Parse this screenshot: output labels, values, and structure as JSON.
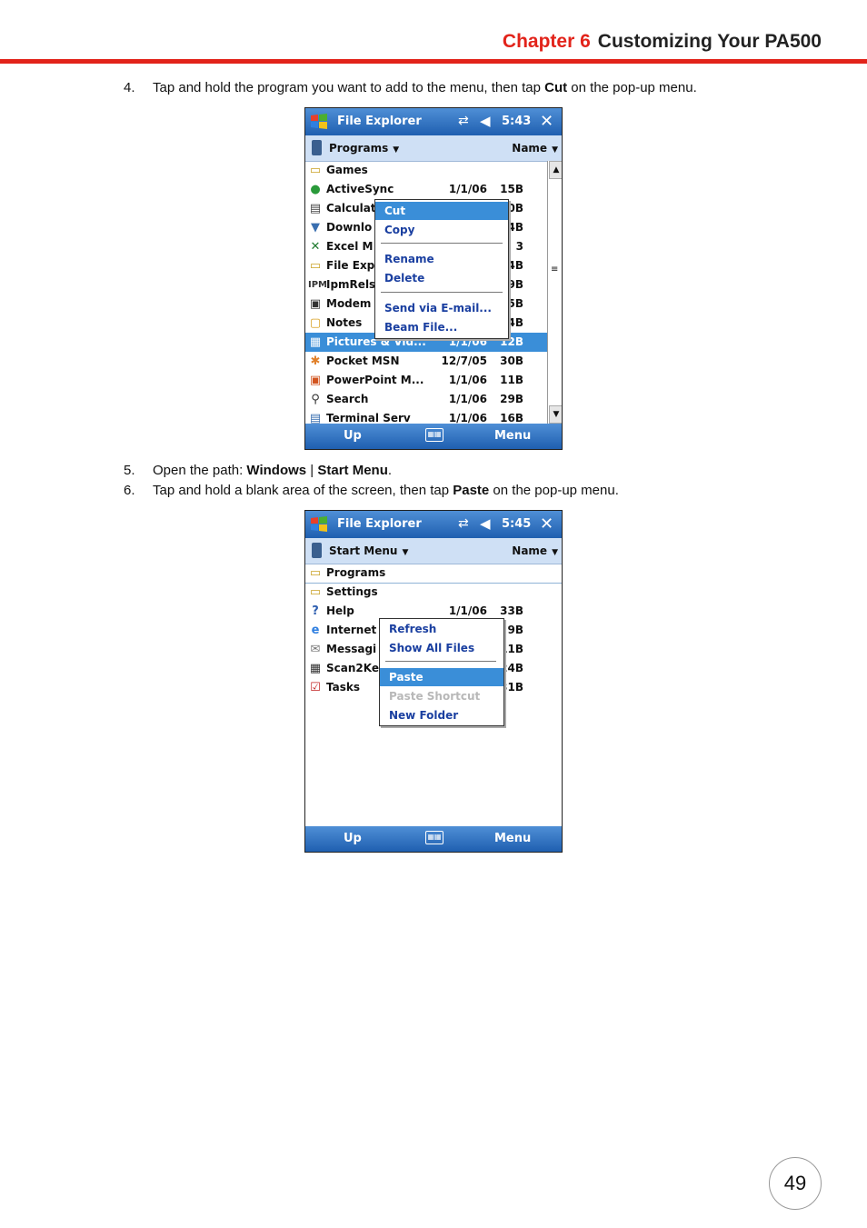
{
  "header": {
    "chapter": "Chapter 6",
    "title": "Customizing Your PA500",
    "rule_color": "#e2231a"
  },
  "steps": [
    {
      "num": "4.",
      "pre": "Tap and hold the program you want to add to the menu, then tap ",
      "b1": "Cut",
      "post": " on the pop-up menu."
    },
    {
      "num": "5.",
      "pre": "Open the path: ",
      "b1": "Windows",
      "mid": " | ",
      "b2": "Start Menu",
      "post": "."
    },
    {
      "num": "6.",
      "pre": "Tap and hold a blank area of the screen, then tap ",
      "b1": "Paste",
      "post": " on the pop-up menu."
    }
  ],
  "screen1": {
    "app": "File Explorer",
    "time": "5:43",
    "close": "✕",
    "folder": "Programs",
    "sort": "Name",
    "rows": [
      {
        "icon": "folder-icon",
        "name": "Games",
        "date": "",
        "size": ""
      },
      {
        "icon": "activesync-icon",
        "name": "ActiveSync",
        "date": "1/1/06",
        "size": "15B"
      },
      {
        "icon": "calculator-icon",
        "name": "Calculat",
        "date": "",
        "size": "0B"
      },
      {
        "icon": "download-icon",
        "name": "Downlo",
        "date": "",
        "size": "4B"
      },
      {
        "icon": "excel-icon",
        "name": "Excel M",
        "date": "",
        "size": "3"
      },
      {
        "icon": "file-explorer-icon",
        "name": "File Expl",
        "date": "",
        "size": "4B"
      },
      {
        "icon": "ipm-icon",
        "name": "IpmRels",
        "date": "",
        "size": "9B"
      },
      {
        "icon": "modem-icon",
        "name": "Modem",
        "date": "",
        "size": "5B"
      },
      {
        "icon": "notes-icon",
        "name": "Notes",
        "date": "",
        "size": "4B"
      },
      {
        "icon": "pictures-icon",
        "name": "Pictures & Vid...",
        "date": "1/1/06",
        "size": "12B"
      },
      {
        "icon": "msn-icon",
        "name": "Pocket MSN",
        "date": "12/7/05",
        "size": "30B"
      },
      {
        "icon": "powerpoint-icon",
        "name": "PowerPoint M...",
        "date": "1/1/06",
        "size": "11B"
      },
      {
        "icon": "search-icon",
        "name": "Search",
        "date": "1/1/06",
        "size": "29B"
      },
      {
        "icon": "terminal-icon",
        "name": "Terminal Serv",
        "date": "1/1/06",
        "size": "16B"
      }
    ],
    "menu": [
      "Cut",
      "Copy",
      "Rename",
      "Delete",
      "Send via E-mail...",
      "Beam File..."
    ],
    "bottom": {
      "left": "Up",
      "right": "Menu"
    }
  },
  "screen2": {
    "app": "File Explorer",
    "time": "5:45",
    "close": "✕",
    "folder": "Start Menu",
    "sort": "Name",
    "rows": [
      {
        "icon": "folder-icon",
        "name": "Programs",
        "date": "",
        "size": ""
      },
      {
        "icon": "folder-icon",
        "name": "Settings",
        "date": "",
        "size": ""
      },
      {
        "icon": "help-icon",
        "name": "Help",
        "date": "1/1/06",
        "size": "33B"
      },
      {
        "icon": "internet-explorer-icon",
        "name": "Internet",
        "date": "",
        "size": "9B"
      },
      {
        "icon": "messaging-icon",
        "name": "Messagi",
        "date": "",
        "size": "11B"
      },
      {
        "icon": "keyboard-icon",
        "name": "Scan2Ke",
        "date": "",
        "size": "24B"
      },
      {
        "icon": "tasks-icon",
        "name": "Tasks",
        "date": "",
        "size": "31B"
      }
    ],
    "menu": [
      "Refresh",
      "Show All Files",
      "Paste",
      "Paste Shortcut",
      "New Folder"
    ],
    "bottom": {
      "left": "Up",
      "right": "Menu"
    }
  },
  "page_number": "49"
}
